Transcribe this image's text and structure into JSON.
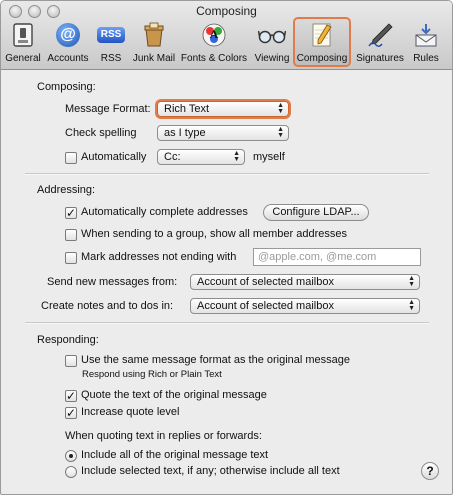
{
  "window": {
    "title": "Composing"
  },
  "toolbar": {
    "items": [
      {
        "label": "General",
        "icon": "general-switch-icon"
      },
      {
        "label": "Accounts",
        "icon": "at-sign-icon"
      },
      {
        "label": "RSS",
        "icon": "rss-icon"
      },
      {
        "label": "Junk Mail",
        "icon": "junk-mail-bin-icon"
      },
      {
        "label": "Fonts & Colors",
        "icon": "color-palette-icon"
      },
      {
        "label": "Viewing",
        "icon": "glasses-icon"
      },
      {
        "label": "Composing",
        "icon": "pencil-notepad-icon"
      },
      {
        "label": "Signatures",
        "icon": "signature-pen-icon"
      },
      {
        "label": "Rules",
        "icon": "rules-envelope-icon"
      }
    ],
    "rss_text": "RSS",
    "accounts_symbol": "@",
    "selected": "Composing"
  },
  "composing": {
    "heading": "Composing:",
    "message_format_label": "Message Format:",
    "message_format_value": "Rich Text",
    "check_spelling_label": "Check spelling",
    "check_spelling_value": "as I type",
    "auto_cc_label": "Automatically",
    "auto_cc_value": "Cc:",
    "auto_cc_suffix": "myself",
    "auto_cc_checked": false
  },
  "addressing": {
    "heading": "Addressing:",
    "auto_complete_label": "Automatically complete addresses",
    "auto_complete_checked": true,
    "configure_ldap_label": "Configure LDAP...",
    "group_label": "When sending to a group, show all member addresses",
    "group_checked": false,
    "mark_label": "Mark addresses not ending with",
    "mark_checked": false,
    "mark_placeholder": "@apple.com, @me.com",
    "send_from_label": "Send new messages from:",
    "send_from_value": "Account of selected mailbox",
    "notes_label": "Create notes and to dos in:",
    "notes_value": "Account of selected mailbox"
  },
  "responding": {
    "heading": "Responding:",
    "same_format_label": "Use the same message format as the original message",
    "same_format_checked": false,
    "same_format_sub": "Respond using Rich or Plain Text",
    "quote_label": "Quote the text of the original message",
    "quote_checked": true,
    "increase_label": "Increase quote level",
    "increase_checked": true,
    "when_quoting_label": "When quoting text in replies or forwards:",
    "include_all_label": "Include all of the original message text",
    "include_all_selected": true,
    "include_selected_label": "Include selected text, if any; otherwise include all text",
    "include_selected_selected": false
  },
  "help_label": "?",
  "checkmark": "✓",
  "colors": {
    "highlight": "#e07c4a"
  }
}
